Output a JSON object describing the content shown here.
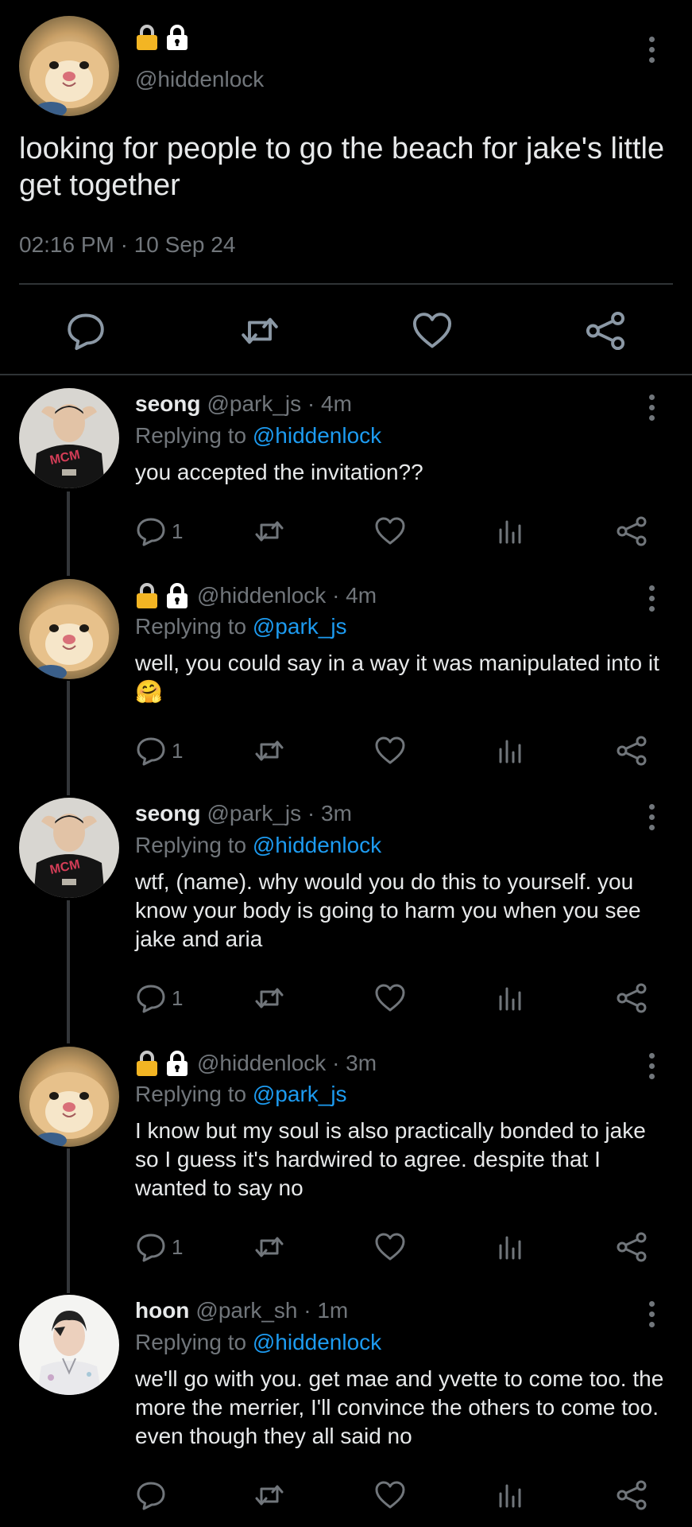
{
  "main_post": {
    "handle": "@hiddenlock",
    "text": "looking for people to go the beach for jake's little get together",
    "timestamp": "02:16 PM · 10 Sep 24"
  },
  "replies": [
    {
      "name": "seong",
      "handle_time": "@park_js · 4m",
      "replying_prefix": "Replying to ",
      "replying_to": "@hiddenlock",
      "text": "you accepted the invitation??",
      "reply_count": "1"
    },
    {
      "name": "",
      "handle_time": "@hiddenlock · 4m",
      "replying_prefix": "Replying to ",
      "replying_to": "@park_js",
      "text": "well, you could say in a way it was manipulated into it🤗",
      "reply_count": "1"
    },
    {
      "name": "seong",
      "handle_time": "@park_js · 3m",
      "replying_prefix": "Replying to ",
      "replying_to": "@hiddenlock",
      "text": "wtf, (name). why would you do this to yourself. you know your body is going to harm you when you see jake and aria",
      "reply_count": "1"
    },
    {
      "name": "",
      "handle_time": "@hiddenlock · 3m",
      "replying_prefix": "Replying to ",
      "replying_to": "@park_js",
      "text": "I know but my soul is also practically bonded to jake so I guess it's hardwired to agree. despite that I wanted to say no",
      "reply_count": "1"
    },
    {
      "name": "hoon",
      "handle_time": "@park_sh · 1m",
      "replying_prefix": "Replying to ",
      "replying_to": "@hiddenlock",
      "text": "we'll go with you. get mae and yvette to come too. the more the merrier, I'll convince the others to come too. even though they all said no",
      "reply_count": ""
    }
  ],
  "icons": {
    "lock_badges": [
      "gold-lock-icon",
      "white-lock-icon"
    ],
    "actions": [
      "reply-icon",
      "retweet-icon",
      "like-icon",
      "views-icon",
      "share-icon"
    ]
  },
  "colors": {
    "background": "#000000",
    "text": "#e7e9ea",
    "muted": "#71767b",
    "mention": "#1d9bf0",
    "divider": "#2f3336"
  }
}
